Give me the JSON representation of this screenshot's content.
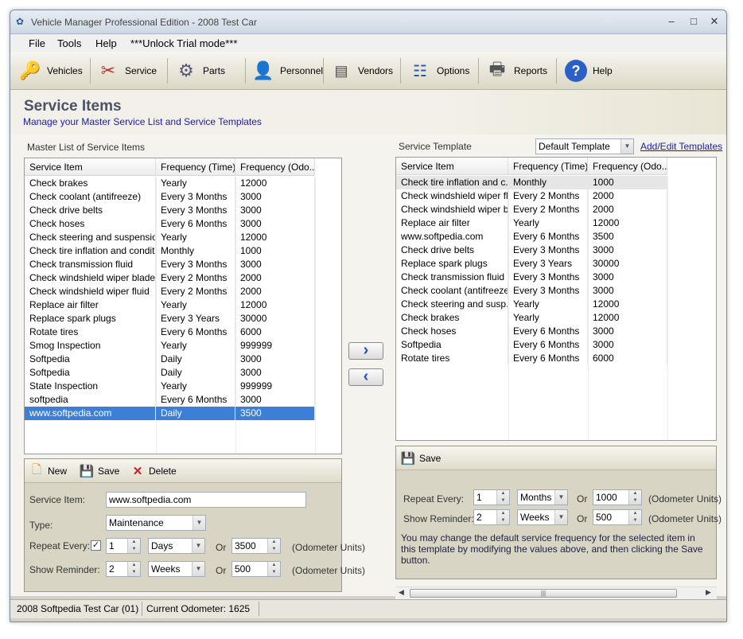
{
  "window": {
    "title": "Vehicle Manager Professional Edition - 2008 Test Car"
  },
  "menu": [
    "File",
    "Tools",
    "Help",
    "***Unlock Trial mode***"
  ],
  "toolbar": [
    {
      "label": "Vehicles",
      "icon": "keys-icon"
    },
    {
      "label": "Service",
      "icon": "wrench-icon"
    },
    {
      "label": "Parts",
      "icon": "gears-icon"
    },
    {
      "label": "Personnel",
      "icon": "person-icon"
    },
    {
      "label": "Vendors",
      "icon": "card-icon"
    },
    {
      "label": "Options",
      "icon": "options-icon"
    },
    {
      "label": "Reports",
      "icon": "printer-icon"
    },
    {
      "label": "Help",
      "icon": "question-icon"
    }
  ],
  "page": {
    "title": "Service Items",
    "subtitle": "Manage your Master Service List and Service Templates"
  },
  "master": {
    "group_label": "Master List of Service Items",
    "columns": [
      "Service Item",
      "Frequency (Time)",
      "Frequency (Odo..."
    ],
    "rows": [
      [
        "Check brakes",
        "Yearly",
        "12000"
      ],
      [
        "Check coolant (antifreeze)",
        "Every 3 Months",
        "3000"
      ],
      [
        "Check drive belts",
        "Every 3 Months",
        "3000"
      ],
      [
        "Check hoses",
        "Every 6 Months",
        "3000"
      ],
      [
        "Check steering and suspension",
        "Yearly",
        "12000"
      ],
      [
        "Check tire inflation and conditi...",
        "Monthly",
        "1000"
      ],
      [
        "Check transmission fluid",
        "Every 3 Months",
        "3000"
      ],
      [
        "Check windshield wiper blades",
        "Every 2 Months",
        "2000"
      ],
      [
        "Check windshield wiper fluid",
        "Every 2 Months",
        "2000"
      ],
      [
        "Replace air filter",
        "Yearly",
        "12000"
      ],
      [
        "Replace spark plugs",
        "Every 3 Years",
        "30000"
      ],
      [
        "Rotate tires",
        "Every 6 Months",
        "6000"
      ],
      [
        "Smog Inspection",
        "Yearly",
        "999999"
      ],
      [
        "Softpedia",
        "Daily",
        "3000"
      ],
      [
        "Softpedia",
        "Daily",
        "3000"
      ],
      [
        "State Inspection",
        "Yearly",
        "999999"
      ],
      [
        "softpedia",
        "Every 6 Months",
        "3000"
      ],
      [
        "www.softpedia.com",
        "Daily",
        "3500"
      ]
    ],
    "selected_index": 17
  },
  "editor": {
    "new_label": "New",
    "save_label": "Save",
    "delete_label": "Delete",
    "service_item_label": "Service Item:",
    "service_item_value": "www.softpedia.com",
    "type_label": "Type:",
    "type_value": "Maintenance",
    "repeat_label": "Repeat Every:",
    "repeat_checked": "✓",
    "repeat_value": "1",
    "repeat_unit": "Days",
    "or_label": "Or",
    "repeat_odo": "3500",
    "odo_units": "(Odometer Units)",
    "reminder_label": "Show Reminder:",
    "reminder_value": "2",
    "reminder_unit": "Weeks",
    "reminder_odo": "500"
  },
  "template": {
    "group_label": "Service Template",
    "selected_template": "Default Template",
    "add_edit_link": "Add/Edit Templates",
    "columns": [
      "Service Item",
      "Frequency (Time)",
      "Frequency (Odo..."
    ],
    "rows": [
      [
        "Check tire inflation and c...",
        "Monthly",
        "1000"
      ],
      [
        "Check windshield wiper fl...",
        "Every 2 Months",
        "2000"
      ],
      [
        "Check windshield wiper b...",
        "Every 2 Months",
        "2000"
      ],
      [
        "Replace air filter",
        "Yearly",
        "12000"
      ],
      [
        "www.softpedia.com",
        "Every 6 Months",
        "3500"
      ],
      [
        "Check drive belts",
        "Every 3 Months",
        "3000"
      ],
      [
        "Replace spark plugs",
        "Every 3 Years",
        "30000"
      ],
      [
        "Check transmission fluid",
        "Every 3 Months",
        "3000"
      ],
      [
        "Check coolant (antifreeze)",
        "Every 3 Months",
        "3000"
      ],
      [
        "Check steering and susp...",
        "Yearly",
        "12000"
      ],
      [
        "Check brakes",
        "Yearly",
        "12000"
      ],
      [
        "Check hoses",
        "Every 6 Months",
        "3000"
      ],
      [
        "Softpedia",
        "Every 6 Months",
        "3000"
      ],
      [
        "Rotate tires",
        "Every 6 Months",
        "6000"
      ]
    ]
  },
  "template_editor": {
    "save_label": "Save",
    "repeat_label": "Repeat Every:",
    "repeat_value": "1",
    "repeat_unit": "Months",
    "or_label": "Or",
    "repeat_odo": "1000",
    "reminder_label": "Show Reminder:",
    "reminder_value": "2",
    "reminder_unit": "Weeks",
    "reminder_odo": "500",
    "odo_units": "(Odometer Units)",
    "help_text": "You may change the default service frequency for the selected item in this template by modifying the values above, and then clicking the Save button."
  },
  "status": {
    "vehicle": "2008 Softpedia Test Car (01)",
    "odometer": "Current Odometer: 1625"
  },
  "colors": {
    "accent": "#3d7fd6",
    "link": "#1a1aa8",
    "panel": "#d8d5c4"
  }
}
